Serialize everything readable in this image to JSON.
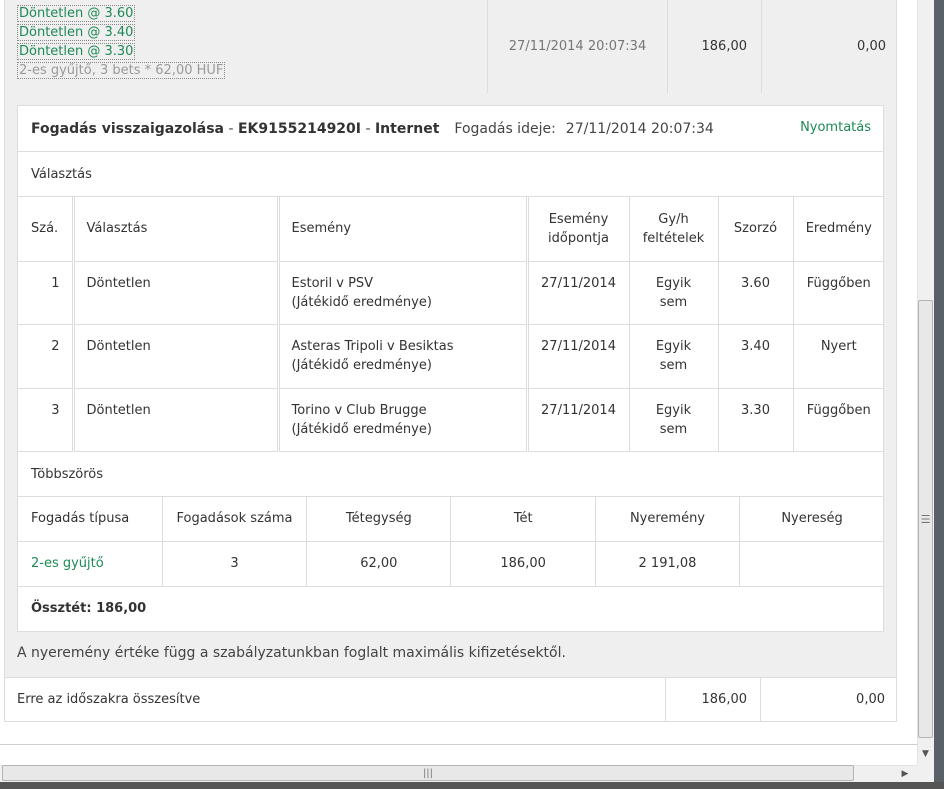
{
  "top": {
    "selections": [
      "Döntetlen @  3.60",
      "Döntetlen @  3.40",
      "Döntetlen @  3.30"
    ],
    "summary": "2-es gyűjtő, 3  bets * 62,00 HUF",
    "date": "27/11/2014 20:07:34",
    "stake": "186,00",
    "return": "0,00"
  },
  "confirmation": {
    "title": "Fogadás visszaigazolása",
    "sep1": " - ",
    "ref": "EK9155214920I",
    "sep2": " - ",
    "channel": "Internet",
    "time_label": "Fogadás ideje:",
    "time": "27/11/2014 20:07:34",
    "print": "Nyomtatás"
  },
  "selection_section": "Választás",
  "selection_table": {
    "headers": [
      "Szá.",
      "Választás",
      "Esemény",
      "Esemény időpontja",
      "Gy/h feltételek",
      "Szorzó",
      "Eredmény"
    ],
    "rows": [
      {
        "no": "1",
        "pick": "Döntetlen",
        "event": "Estoril v PSV",
        "market": "(Játékidő eredménye)",
        "date": "27/11/2014",
        "ew": "Egyik sem",
        "odds": "3.60",
        "result": "Függőben"
      },
      {
        "no": "2",
        "pick": "Döntetlen",
        "event": "Asteras Tripoli v Besiktas",
        "market": "(Játékidő eredménye)",
        "date": "27/11/2014",
        "ew": "Egyik sem",
        "odds": "3.40",
        "result": "Nyert"
      },
      {
        "no": "3",
        "pick": "Döntetlen",
        "event": "Torino v Club Brugge",
        "market": "(Játékidő eredménye)",
        "date": "27/11/2014",
        "ew": "Egyik sem",
        "odds": "3.30",
        "result": "Függőben"
      }
    ]
  },
  "multiple_section": "Többszörös",
  "multiple_table": {
    "headers": [
      "Fogadás típusa",
      "Fogadások száma",
      "Tétegység",
      "Tét",
      "Nyeremény",
      "Nyereség"
    ],
    "row": {
      "type": "2-es gyűjtő",
      "count": "3",
      "unit": "62,00",
      "stake": "186,00",
      "win": "2 191,08",
      "profit": ""
    }
  },
  "total": "Össztét: 186,00",
  "note": "A nyeremény értéke függ a szabályzatunkban foglalt maximális kifizetésektől.",
  "period": {
    "label": "Erre az időszakra összesítve",
    "stake": "186,00",
    "return": "0,00"
  },
  "icons": {
    "scroll_up": "triangle-up",
    "scroll_down": "triangle-down",
    "scroll_left": "triangle-left",
    "scroll_right": "triangle-right",
    "grip": "grip-lines"
  }
}
